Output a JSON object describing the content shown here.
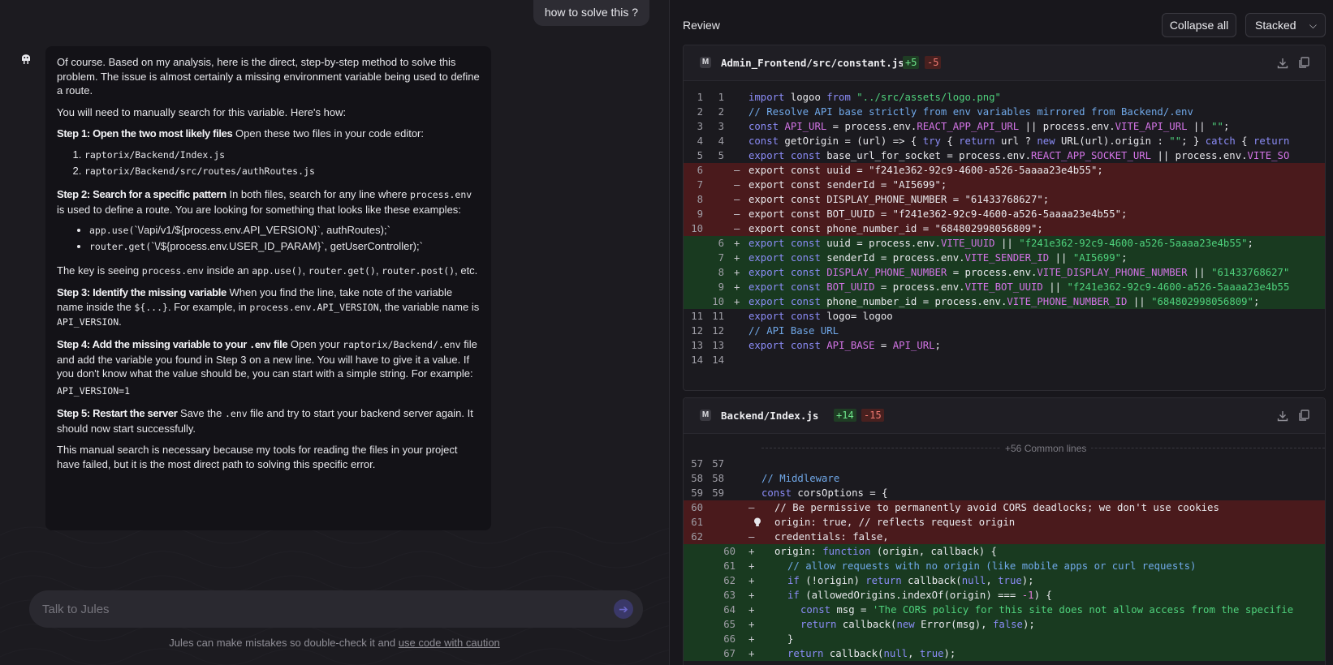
{
  "chat": {
    "user_message": "how to solve this ?",
    "bot": {
      "intro": "Of course. Based on my analysis, here is the direct, step-by-step method to solve this problem. The issue is almost certainly a missing environment variable being used to define a route.",
      "manual": "You will need to manually search for this variable. Here's how:",
      "step1_title": "Step 1: Open the two most likely files",
      "step1_text": " Open these two files in your code editor:",
      "step1_files": [
        "raptorix/Backend/Index.js",
        "raptorix/Backend/src/routes/authRoutes.js"
      ],
      "step2_title": "Step 2: Search for a specific pattern",
      "step2_text_a": " In both files, search for any line where ",
      "step2_code": "process.env",
      "step2_text_b": " is used to define a route. You are looking for something that looks like these examples:",
      "step2_examples": [
        {
          "code": "app.use(",
          "text": "`\\/api/v1/${process.env.API_VERSION}`, authRoutes);`"
        },
        {
          "code": "router.get(",
          "text": "`\\/${process.env.USER_ID_PARAM}`, getUserController);`"
        }
      ],
      "key_a": "The key is seeing ",
      "key_code1": "process.env",
      "key_b": " inside an ",
      "key_code2": "app.use()",
      "key_c": ", ",
      "key_code3": "router.get()",
      "key_d": ", ",
      "key_code4": "router.post()",
      "key_e": ", etc.",
      "step3_title": "Step 3: Identify the missing variable",
      "step3_a": " When you find the line, take note of the variable name inside the ",
      "step3_code1": "${...}",
      "step3_b": ". For example, in ",
      "step3_code2": "process.env.API_VERSION",
      "step3_c": ", the variable name is ",
      "step3_code3": "API_VERSION",
      "step3_d": ".",
      "step4_title_a": "Step 4: Add the missing variable to your ",
      "step4_title_code": ".env",
      "step4_title_b": " file",
      "step4_a": " Open your ",
      "step4_code": "raptorix/Backend/.env",
      "step4_b": " file and add the variable you found in Step 3 on a new line. You will have to give it a value. If you don't know what the value should be, you can start with a simple string. For example:",
      "step4_example": "API_VERSION=1",
      "step5_title": "Step 5: Restart the server",
      "step5_a": " Save the ",
      "step5_code": ".env",
      "step5_b": " file and try to start your backend server again. It should now start successfully.",
      "closing": "This manual search is necessary because my tools for reading the files in your project have failed, but it is the most direct path to solving this specific error."
    },
    "composer_placeholder": "Talk to Jules",
    "disclaimer_text": "Jules can make mistakes so double-check it and ",
    "disclaimer_link": "use code with caution"
  },
  "review": {
    "title": "Review",
    "collapse_all": "Collapse all",
    "view_mode": "Stacked",
    "files": [
      {
        "name": "Admin_Frontend/src/constant.js",
        "additions": "+5",
        "deletions": "-5",
        "badge": "M"
      },
      {
        "name": "Backend/Index.js",
        "additions": "+14",
        "deletions": "-15",
        "badge": "M",
        "common_lines": "+56 Common lines"
      }
    ]
  },
  "colors": {
    "added_bg": "#193a20",
    "deleted_bg": "#4a1a1c",
    "keyword": "#8b8cf7",
    "string": "#4fd17c",
    "env_var": "#d374e6",
    "comment": "#70a8e8"
  }
}
